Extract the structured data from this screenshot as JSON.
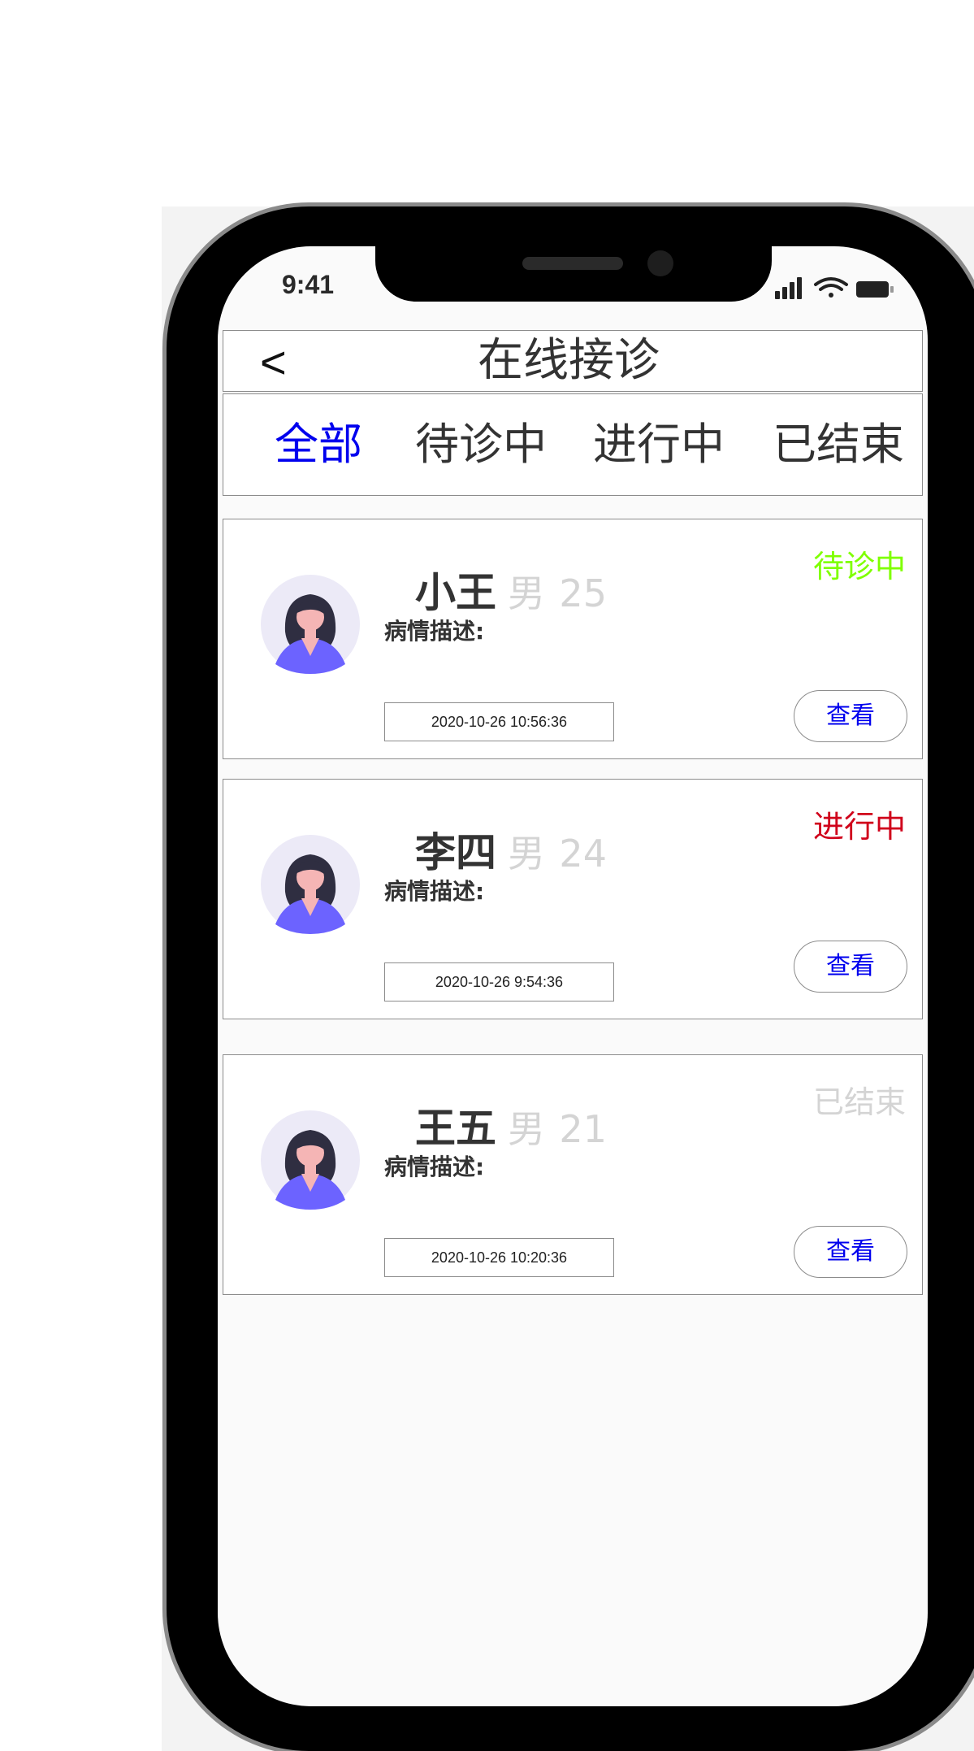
{
  "status_bar": {
    "time": "9:41"
  },
  "header": {
    "back_label": "<",
    "title": "在线接诊"
  },
  "tabs": [
    {
      "label": "全部",
      "active": true
    },
    {
      "label": "待诊中",
      "active": false
    },
    {
      "label": "进行中",
      "active": false
    },
    {
      "label": "已结束",
      "active": false
    }
  ],
  "colors": {
    "accent": "#0000ee",
    "status_waiting": "#7fff00",
    "status_in_progress": "#d0021b",
    "status_finished": "#d4d4d4"
  },
  "patients": [
    {
      "name": "小王",
      "gender": "男",
      "age": "25",
      "status": "待诊中",
      "status_color": "#7fff00",
      "desc_label": "病情描述:",
      "datetime": "2020-10-26  10:56:36",
      "view_label": "查看",
      "avatar_icon": "female-avatar-icon"
    },
    {
      "name": "李四",
      "gender": "男",
      "age": "24",
      "status": "进行中",
      "status_color": "#d0021b",
      "desc_label": "病情描述:",
      "datetime": "2020-10-26  9:54:36",
      "view_label": "查看",
      "avatar_icon": "female-avatar-icon"
    },
    {
      "name": "王五",
      "gender": "男",
      "age": "21",
      "status": "已结束",
      "status_color": "#d4d4d4",
      "desc_label": "病情描述:",
      "datetime": "2020-10-26  10:20:36",
      "view_label": "查看",
      "avatar_icon": "female-avatar-icon"
    }
  ]
}
